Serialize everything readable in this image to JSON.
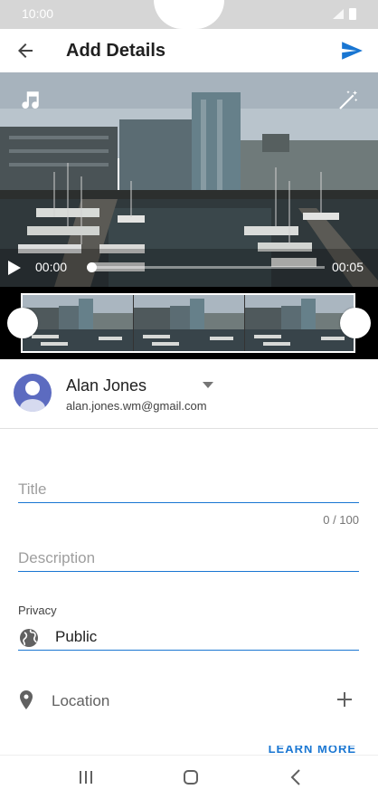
{
  "status_bar": {
    "time": "10:00"
  },
  "app_bar": {
    "title": "Add Details",
    "back_icon": "arrow-back-icon",
    "send_icon": "send-icon"
  },
  "video": {
    "current_time": "00:00",
    "duration": "00:05",
    "progress": 0.0,
    "icons": [
      "music-note-icon",
      "magic-wand-icon",
      "play-icon"
    ]
  },
  "account": {
    "name": "Alan Jones",
    "email": "alan.jones.wm@gmail.com"
  },
  "form": {
    "title": {
      "placeholder": "Title",
      "value": "",
      "counter": "0 / 100"
    },
    "description": {
      "placeholder": "Description",
      "value": ""
    },
    "privacy": {
      "label": "Privacy",
      "value": "Public"
    },
    "location": {
      "label": "Location"
    },
    "learn_more": "LEARN MORE"
  },
  "colors": {
    "accent": "#1976d2",
    "avatar": "#5c6bc0",
    "statusbar": "#d6d6d6"
  }
}
